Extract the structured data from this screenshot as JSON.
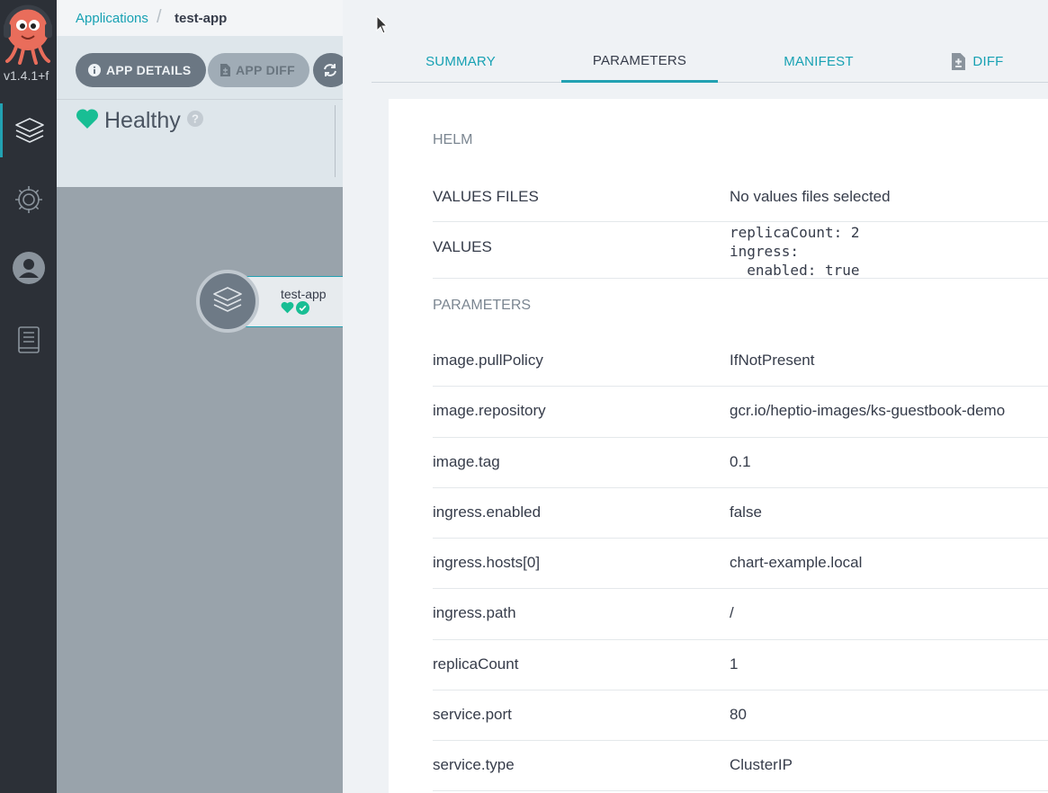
{
  "nav": {
    "version": "v1.4.1+f",
    "items": [
      "applications-icon",
      "settings-icon",
      "user-icon",
      "docs-icon"
    ]
  },
  "breadcrumb": {
    "parent": "Applications",
    "current": "test-app"
  },
  "toolbar": {
    "app_details": "APP DETAILS",
    "app_diff": "APP DIFF"
  },
  "status": {
    "health": "Healthy"
  },
  "graph": {
    "node_name": "test-app"
  },
  "tabs": {
    "summary": "SUMMARY",
    "parameters": "PARAMETERS",
    "manifest": "MANIFEST",
    "diff": "DIFF",
    "active": "parameters"
  },
  "helm": {
    "title": "HELM",
    "values_files_label": "VALUES FILES",
    "values_files_value": "No values files selected",
    "values_label": "VALUES",
    "values_value": "replicaCount: 2\ningress:\n  enabled: true"
  },
  "parameters": {
    "title": "PARAMETERS",
    "rows": [
      {
        "name": "image.pullPolicy",
        "value": "IfNotPresent"
      },
      {
        "name": "image.repository",
        "value": "gcr.io/heptio-images/ks-guestbook-demo"
      },
      {
        "name": "image.tag",
        "value": "0.1"
      },
      {
        "name": "ingress.enabled",
        "value": "false"
      },
      {
        "name": "ingress.hosts[0]",
        "value": "chart-example.local"
      },
      {
        "name": "ingress.path",
        "value": "/"
      },
      {
        "name": "replicaCount",
        "value": "1"
      },
      {
        "name": "service.port",
        "value": "80"
      },
      {
        "name": "service.type",
        "value": "ClusterIP"
      }
    ]
  },
  "colors": {
    "accent": "#22a1b2",
    "healthy": "#18be94",
    "nav_bg": "#2c3037"
  }
}
